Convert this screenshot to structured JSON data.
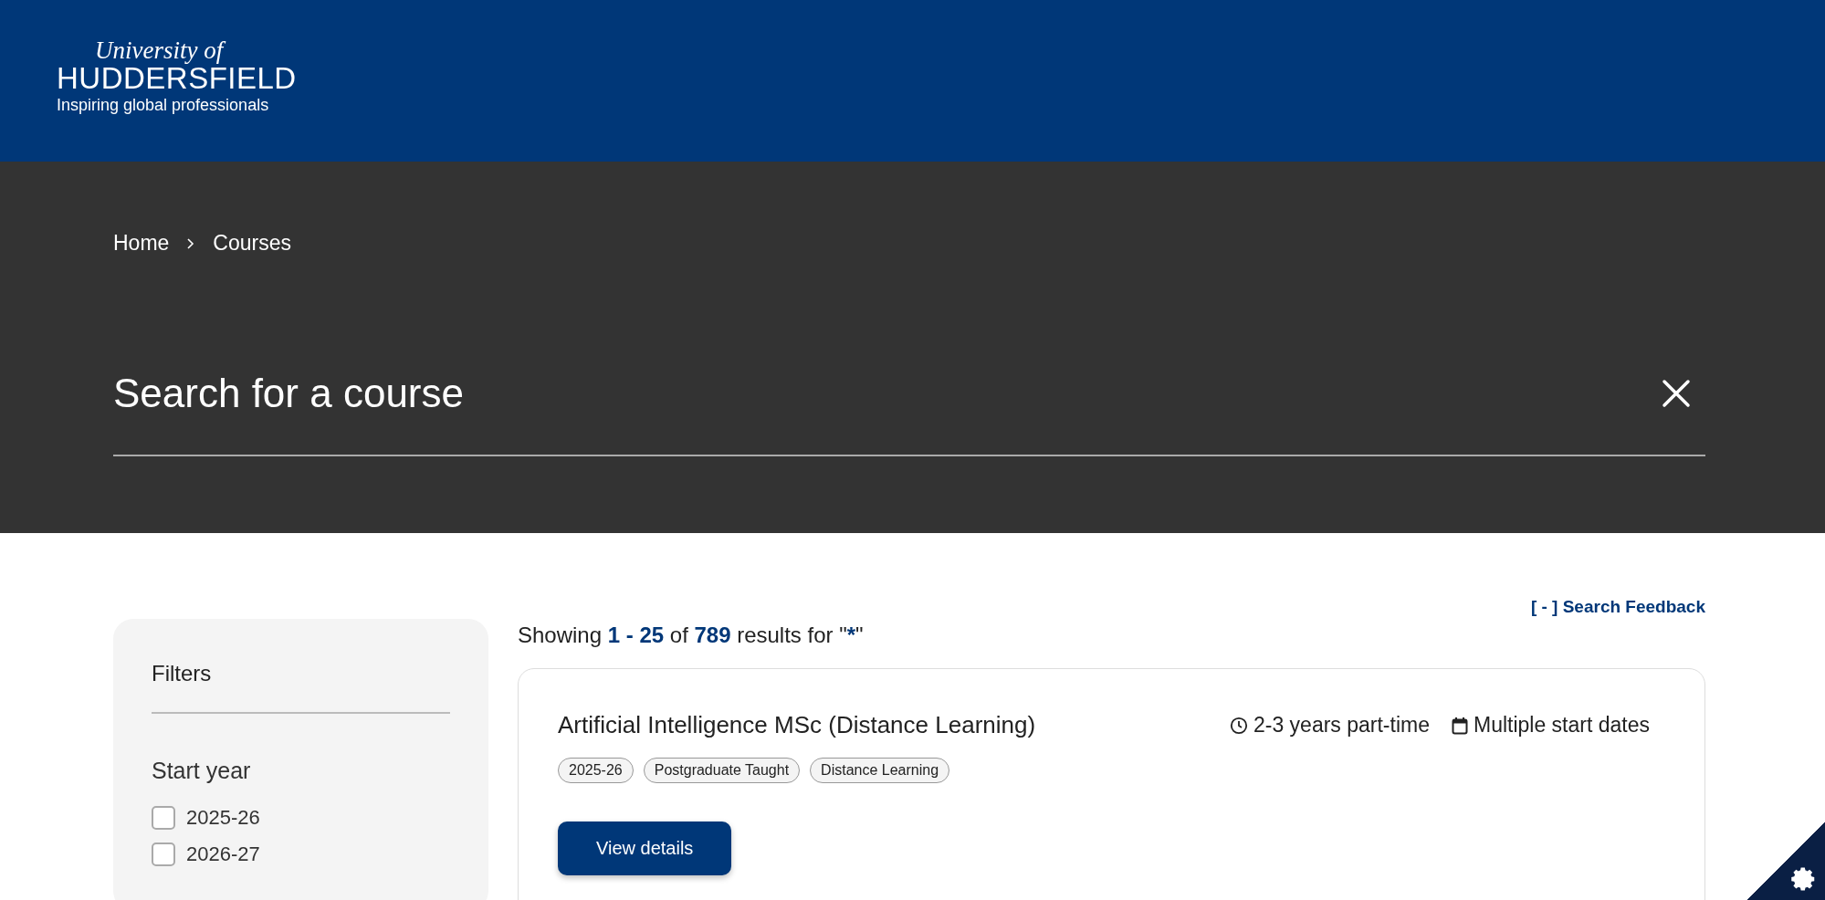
{
  "header": {
    "logo": {
      "line_1": "University of",
      "line_2": "HUDDERSFIELD",
      "tagline": "Inspiring global professionals"
    }
  },
  "breadcrumb": [
    {
      "label": "Home"
    },
    {
      "label": "Courses"
    }
  ],
  "search": {
    "placeholder": "Search for a course"
  },
  "feedback_link": "[ - ] Search Feedback",
  "filters": {
    "title": "Filters",
    "groups": [
      {
        "title": "Start year",
        "options": [
          {
            "label": "2025-26",
            "checked": false
          },
          {
            "label": "2026-27",
            "checked": false
          }
        ]
      }
    ]
  },
  "results": {
    "summary": {
      "lead": "Showing",
      "range": "1 - 25",
      "of": "of",
      "total": "789",
      "tail": "results for \"",
      "query": "*",
      "close": "\""
    },
    "items": [
      {
        "title": "Artificial Intelligence MSc (Distance Learning)",
        "duration": "2-3 years part-time",
        "start": "Multiple start dates",
        "tags": [
          "2025-26",
          "Postgraduate Taught",
          "Distance Learning"
        ],
        "button": "View details"
      }
    ]
  }
}
